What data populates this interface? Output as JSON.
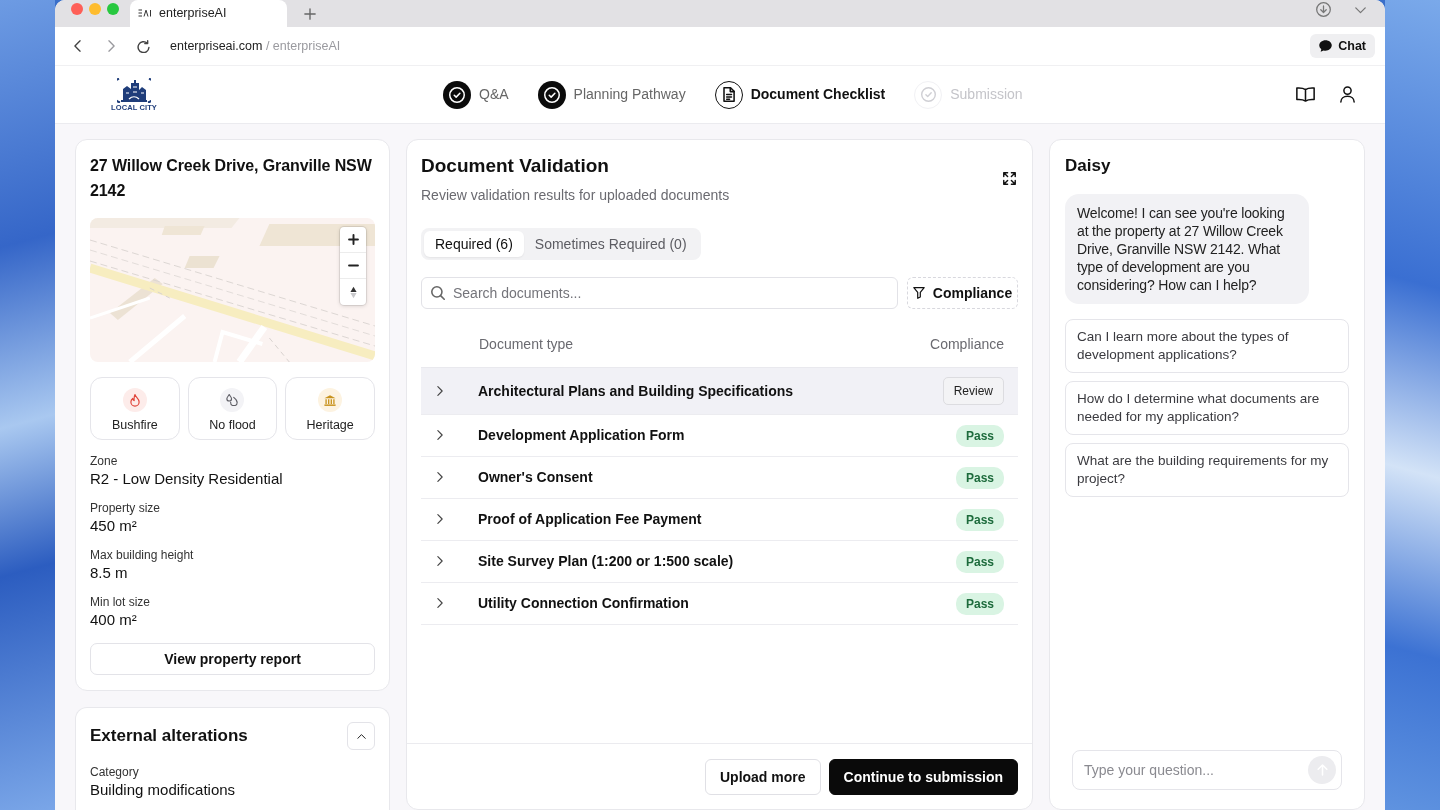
{
  "browser": {
    "tab_title": "enterpriseAI",
    "url": {
      "host": "enterpriseai.com",
      "path": "/ enterpriseAI"
    },
    "chat_button": "Chat"
  },
  "header": {
    "logo_text": "LOCAL CITY",
    "steps": [
      {
        "label": "Q&A",
        "completed": true,
        "current": false
      },
      {
        "label": "Planning Pathway",
        "completed": true,
        "current": false
      },
      {
        "label": "Document Checklist",
        "completed": false,
        "current": true
      },
      {
        "label": "Submission",
        "completed": false,
        "current": false
      }
    ]
  },
  "property": {
    "address": "27 Willow Creek Drive, Granville NSW 2142",
    "hazards": [
      {
        "label": "Bushfire",
        "kind": "fire"
      },
      {
        "label": "No flood",
        "kind": "flood"
      },
      {
        "label": "Heritage",
        "kind": "heritage"
      }
    ],
    "details": [
      {
        "label": "Zone",
        "value": "R2 - Low Density Residential"
      },
      {
        "label": "Property size",
        "value": "450 m²"
      },
      {
        "label": "Max building height",
        "value": "8.5 m"
      },
      {
        "label": "Min lot size",
        "value": "400 m²"
      }
    ],
    "report_button": "View property report"
  },
  "alterations": {
    "title": "External alterations",
    "expanded": true,
    "details": [
      {
        "label": "Category",
        "value": "Building modifications"
      }
    ]
  },
  "documents": {
    "title": "Document Validation",
    "subtitle": "Review validation results for uploaded documents",
    "tabs": [
      {
        "label": "Required (6)",
        "selected": true
      },
      {
        "label": "Sometimes Required (0)",
        "selected": false
      }
    ],
    "search": {
      "placeholder": "Search documents..."
    },
    "filter_button": "Compliance",
    "columns": [
      "Document type",
      "Compliance"
    ],
    "rows": [
      {
        "name": "Architectural Plans and Building Specifications",
        "compliance": "Review",
        "kind": "review",
        "selected": true,
        "expanded": false
      },
      {
        "name": "Development Application Form",
        "compliance": "Pass",
        "kind": "pass",
        "selected": false,
        "expanded": false
      },
      {
        "name": "Owner's Consent",
        "compliance": "Pass",
        "kind": "pass",
        "selected": false,
        "expanded": false
      },
      {
        "name": "Proof of Application Fee Payment",
        "compliance": "Pass",
        "kind": "pass",
        "selected": false,
        "expanded": false
      },
      {
        "name": "Site Survey Plan (1:200 or 1:500 scale)",
        "compliance": "Pass",
        "kind": "pass",
        "selected": false,
        "expanded": false
      },
      {
        "name": "Utility Connection Confirmation",
        "compliance": "Pass",
        "kind": "pass",
        "selected": false,
        "expanded": false
      }
    ],
    "buttons": [
      {
        "label": "Upload more",
        "kind": "secondary"
      },
      {
        "label": "Continue to submission",
        "kind": "primary"
      }
    ]
  },
  "chat": {
    "title": "Daisy",
    "messages": [
      "Welcome! I can see you're looking at the property at 27 Willow Creek Drive, Granville NSW 2142. What type of development are you considering? How can I help?"
    ],
    "suggestions": [
      "Can I learn more about the types of development applications?",
      "How do I determine what documents are needed for my application?",
      "What are the building requirements for my project?"
    ],
    "input": {
      "placeholder": "Type your question..."
    },
    "send": {
      "disabled": true
    }
  }
}
